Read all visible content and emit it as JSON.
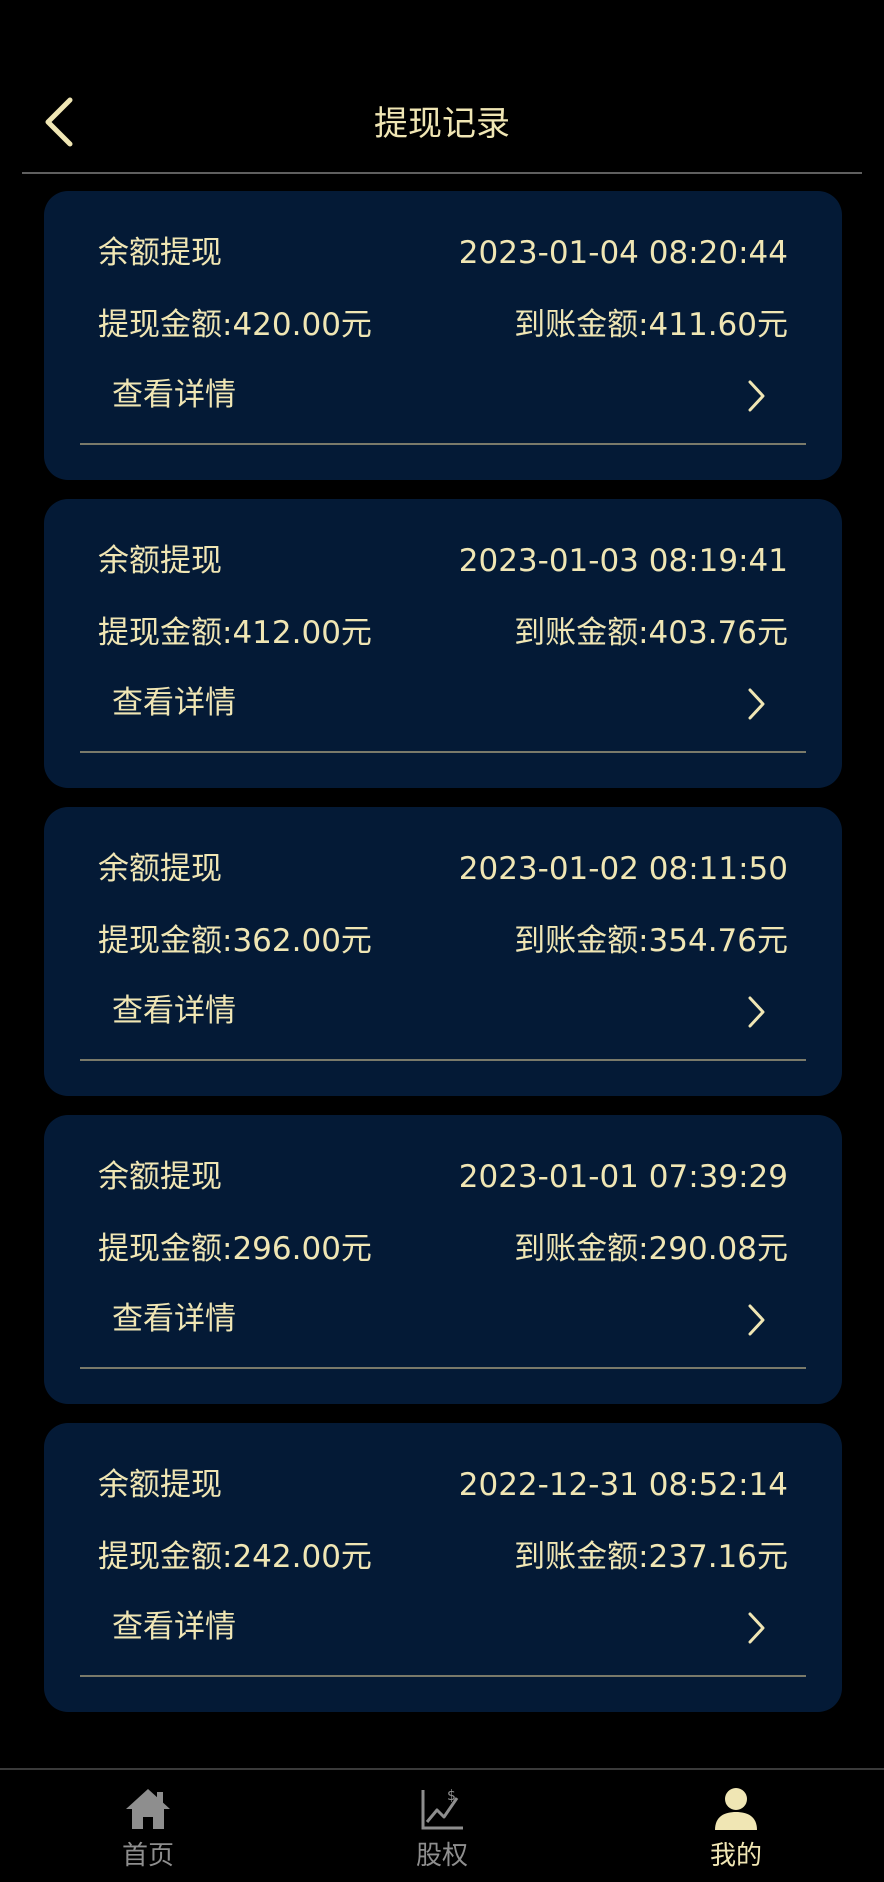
{
  "header": {
    "title": "提现记录"
  },
  "records": [
    {
      "type": "余额提现",
      "time": "2023-01-04 08:20:44",
      "withdraw": "提现金额:420.00元",
      "credited": "到账金额:411.60元",
      "detail": "查看详情"
    },
    {
      "type": "余额提现",
      "time": "2023-01-03 08:19:41",
      "withdraw": "提现金额:412.00元",
      "credited": "到账金额:403.76元",
      "detail": "查看详情"
    },
    {
      "type": "余额提现",
      "time": "2023-01-02 08:11:50",
      "withdraw": "提现金额:362.00元",
      "credited": "到账金额:354.76元",
      "detail": "查看详情"
    },
    {
      "type": "余额提现",
      "time": "2023-01-01 07:39:29",
      "withdraw": "提现金额:296.00元",
      "credited": "到账金额:290.08元",
      "detail": "查看详情"
    },
    {
      "type": "余额提现",
      "time": "2022-12-31 08:52:14",
      "withdraw": "提现金额:242.00元",
      "credited": "到账金额:237.16元",
      "detail": "查看详情"
    }
  ],
  "tabbar": {
    "items": [
      {
        "label": "首页",
        "icon": "home-icon",
        "active": false
      },
      {
        "label": "股权",
        "icon": "equity-chart-icon",
        "active": false
      },
      {
        "label": "我的",
        "icon": "user-icon",
        "active": true
      }
    ]
  },
  "colors": {
    "background": "#000000",
    "card": "#041a36",
    "text": "#f0e6b4",
    "inactive": "#8e8e8e"
  }
}
